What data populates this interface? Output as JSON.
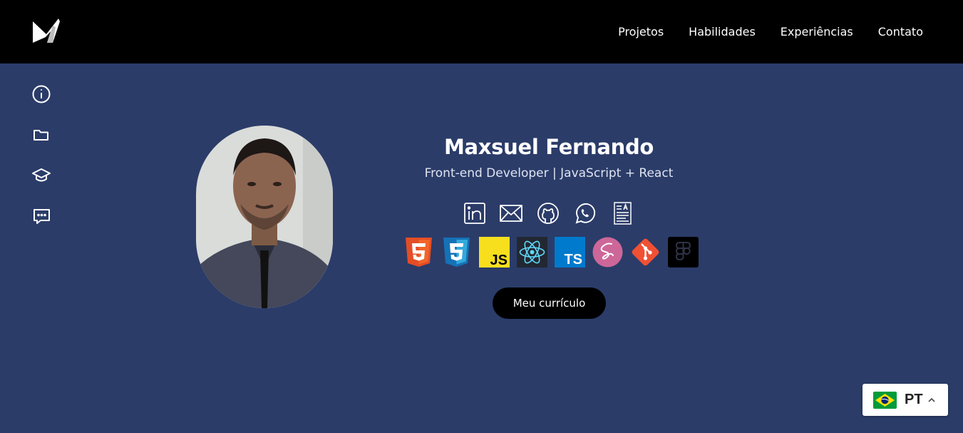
{
  "header": {
    "logo_icon": "m-logo-icon",
    "nav": [
      {
        "label": "Projetos"
      },
      {
        "label": "Habilidades"
      },
      {
        "label": "Experiências"
      },
      {
        "label": "Contato"
      }
    ]
  },
  "sidebar": {
    "items": [
      {
        "icon": "info-icon"
      },
      {
        "icon": "folder-icon"
      },
      {
        "icon": "graduation-cap-icon"
      },
      {
        "icon": "chat-icon"
      }
    ]
  },
  "profile": {
    "name": "Maxsuel Fernando",
    "role": "Front-end Developer | JavaScript + React",
    "social_icons": [
      "linkedin-icon",
      "email-icon",
      "github-icon",
      "whatsapp-icon",
      "resume-icon"
    ],
    "tech_icons": [
      "html5-icon",
      "css3-icon",
      "javascript-icon",
      "react-icon",
      "typescript-icon",
      "sass-icon",
      "git-icon",
      "figma-icon"
    ],
    "cv_button": "Meu currículo"
  },
  "language": {
    "code": "PT",
    "flag_icon": "brazil-flag-icon"
  },
  "colors": {
    "background": "#2b3c69",
    "header": "#000000",
    "button": "#000000"
  }
}
